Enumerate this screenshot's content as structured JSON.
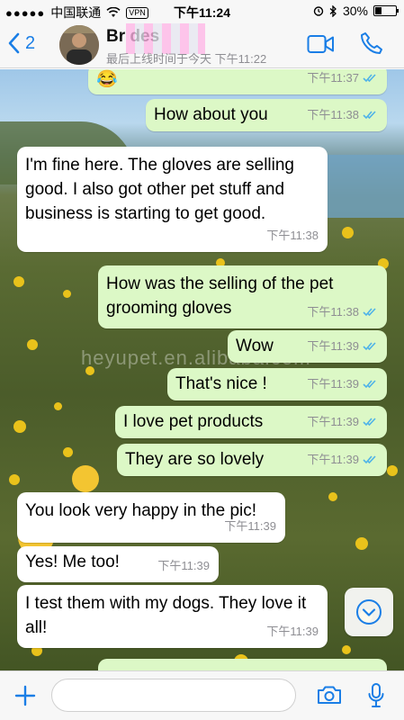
{
  "status_bar": {
    "carrier": "中国联通",
    "vpn": "VPN",
    "time": "下午11:24",
    "battery_text": "30%",
    "battery_level": 0.3
  },
  "header": {
    "back_count": "2",
    "contact_name": "Br        des",
    "contact_status": "最后上线时间于今天 下午11:22"
  },
  "watermark": "heyupet.en.alibaba.com",
  "messages": [
    {
      "dir": "out",
      "text": "😂",
      "time": "下午11:37",
      "ticks": true
    },
    {
      "dir": "out",
      "text": "How about you",
      "time": "下午11:38",
      "ticks": true
    },
    {
      "dir": "in",
      "text": "I'm fine here. The gloves are selling good. I also got other pet stuff and business is starting to get good.",
      "time": "下午11:38"
    },
    {
      "dir": "out",
      "text": "How was the selling of the pet grooming gloves",
      "time": "下午11:38",
      "ticks": true
    },
    {
      "dir": "out",
      "text": "Wow",
      "time": "下午11:39",
      "ticks": true
    },
    {
      "dir": "out",
      "text": "That's nice !",
      "time": "下午11:39",
      "ticks": true
    },
    {
      "dir": "out",
      "text": "I love pet products",
      "time": "下午11:39",
      "ticks": true
    },
    {
      "dir": "out",
      "text": "They are so lovely",
      "time": "下午11:39",
      "ticks": true
    },
    {
      "dir": "in",
      "text": "You look very happy in the pic!",
      "time": "下午11:39"
    },
    {
      "dir": "in",
      "text": "Yes! Me too!",
      "time": "下午11:39"
    },
    {
      "dir": "in",
      "text": "I test them with my dogs. They love it all!",
      "time": "下午11:39"
    }
  ],
  "input": {
    "placeholder": "",
    "value": ""
  },
  "colors": {
    "accent": "#1a7ee6",
    "outgoing_bubble": "#dcf8c6",
    "incoming_bubble": "#ffffff",
    "read_ticks": "#4fb3e8"
  }
}
